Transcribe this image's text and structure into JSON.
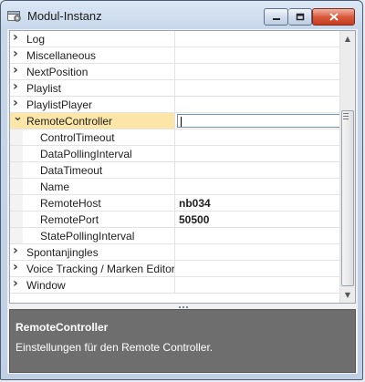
{
  "window": {
    "title": "Modul-Instanz",
    "icons": {
      "app": "gear-icon",
      "minimize": "minimize-icon",
      "maximize": "maximize-icon",
      "close": "close-icon"
    },
    "colors": {
      "selection": "#fbe6a8",
      "help_background": "#6e6e6e",
      "close_button": "#d95a3d"
    }
  },
  "grid": {
    "rows": [
      {
        "label": "Log",
        "kind": "category",
        "expanded": false,
        "value": ""
      },
      {
        "label": "Miscellaneous",
        "kind": "category",
        "expanded": false,
        "value": ""
      },
      {
        "label": "NextPosition",
        "kind": "category",
        "expanded": false,
        "value": ""
      },
      {
        "label": "Playlist",
        "kind": "category",
        "expanded": false,
        "value": ""
      },
      {
        "label": "PlaylistPlayer",
        "kind": "category",
        "expanded": false,
        "value": ""
      },
      {
        "label": "RemoteController",
        "kind": "category",
        "expanded": true,
        "selected": true,
        "value": ""
      },
      {
        "label": "ControlTimeout",
        "kind": "property",
        "value": ""
      },
      {
        "label": "DataPollingInterval",
        "kind": "property",
        "value": ""
      },
      {
        "label": "DataTimeout",
        "kind": "property",
        "value": ""
      },
      {
        "label": "Name",
        "kind": "property",
        "value": ""
      },
      {
        "label": "RemoteHost",
        "kind": "property",
        "value": "nb034"
      },
      {
        "label": "RemotePort",
        "kind": "property",
        "value": "50500"
      },
      {
        "label": "StatePollingInterval",
        "kind": "property",
        "value": ""
      },
      {
        "label": "Spontanjingles",
        "kind": "category",
        "expanded": false,
        "value": ""
      },
      {
        "label": "Voice Tracking / Marken Editor",
        "kind": "category",
        "expanded": false,
        "value": ""
      },
      {
        "label": "Window",
        "kind": "category",
        "expanded": false,
        "value": ""
      }
    ],
    "scrollbar": {
      "up_icon": "arrow-up-icon",
      "down_icon": "arrow-down-icon",
      "grip_icon": "grip-icon"
    }
  },
  "help": {
    "title": "RemoteController",
    "description": "Einstellungen für den Remote Controller."
  }
}
